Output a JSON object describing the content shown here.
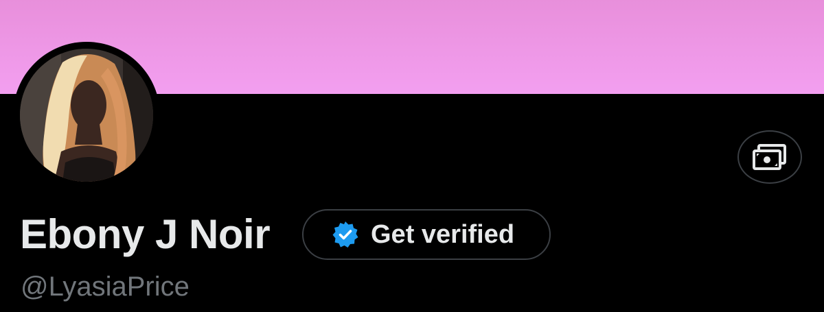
{
  "profile": {
    "display_name": "Ebony J Noir",
    "handle": "@LyasiaPrice",
    "banner_color": "#f39ff0",
    "avatar": "profile-photo"
  },
  "actions": {
    "verify_label": "Get verified",
    "verify_icon": "verified-badge-icon",
    "verify_icon_color": "#1d9bf0",
    "monetize_icon": "money-stack-icon"
  }
}
